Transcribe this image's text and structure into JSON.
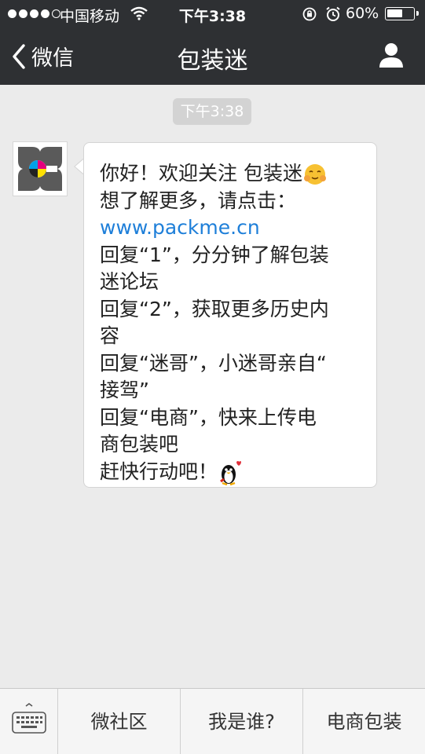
{
  "statusbar": {
    "carrier": "中国移动",
    "time": "下午3:38",
    "battery_percent": "60%",
    "battery_level": 0.6,
    "signal_bars": 4,
    "signal_total": 5
  },
  "nav": {
    "back_label": "微信",
    "title": "包装迷"
  },
  "chat": {
    "timestamp": "下午3:38",
    "message_lines": [
      "你好！欢迎关注 包装迷",
      "想了解更多，请点击：",
      "www.packme.cn",
      "回复“1”，分分钟了解包装",
      "迷论坛",
      "回复“2”，获取更多历史内",
      "容",
      "回复“迷哥”，小迷哥亲自“",
      "接驾”",
      "回复“电商”，快来上传电",
      "商包装吧",
      "赶快行动吧！"
    ]
  },
  "bottom_menu": {
    "items": [
      "微社区",
      "我是谁?",
      "电商包装"
    ]
  },
  "colors": {
    "header_bg": "#2e3033",
    "chat_bg": "#ebebeb",
    "link": "#1e7fd9"
  }
}
